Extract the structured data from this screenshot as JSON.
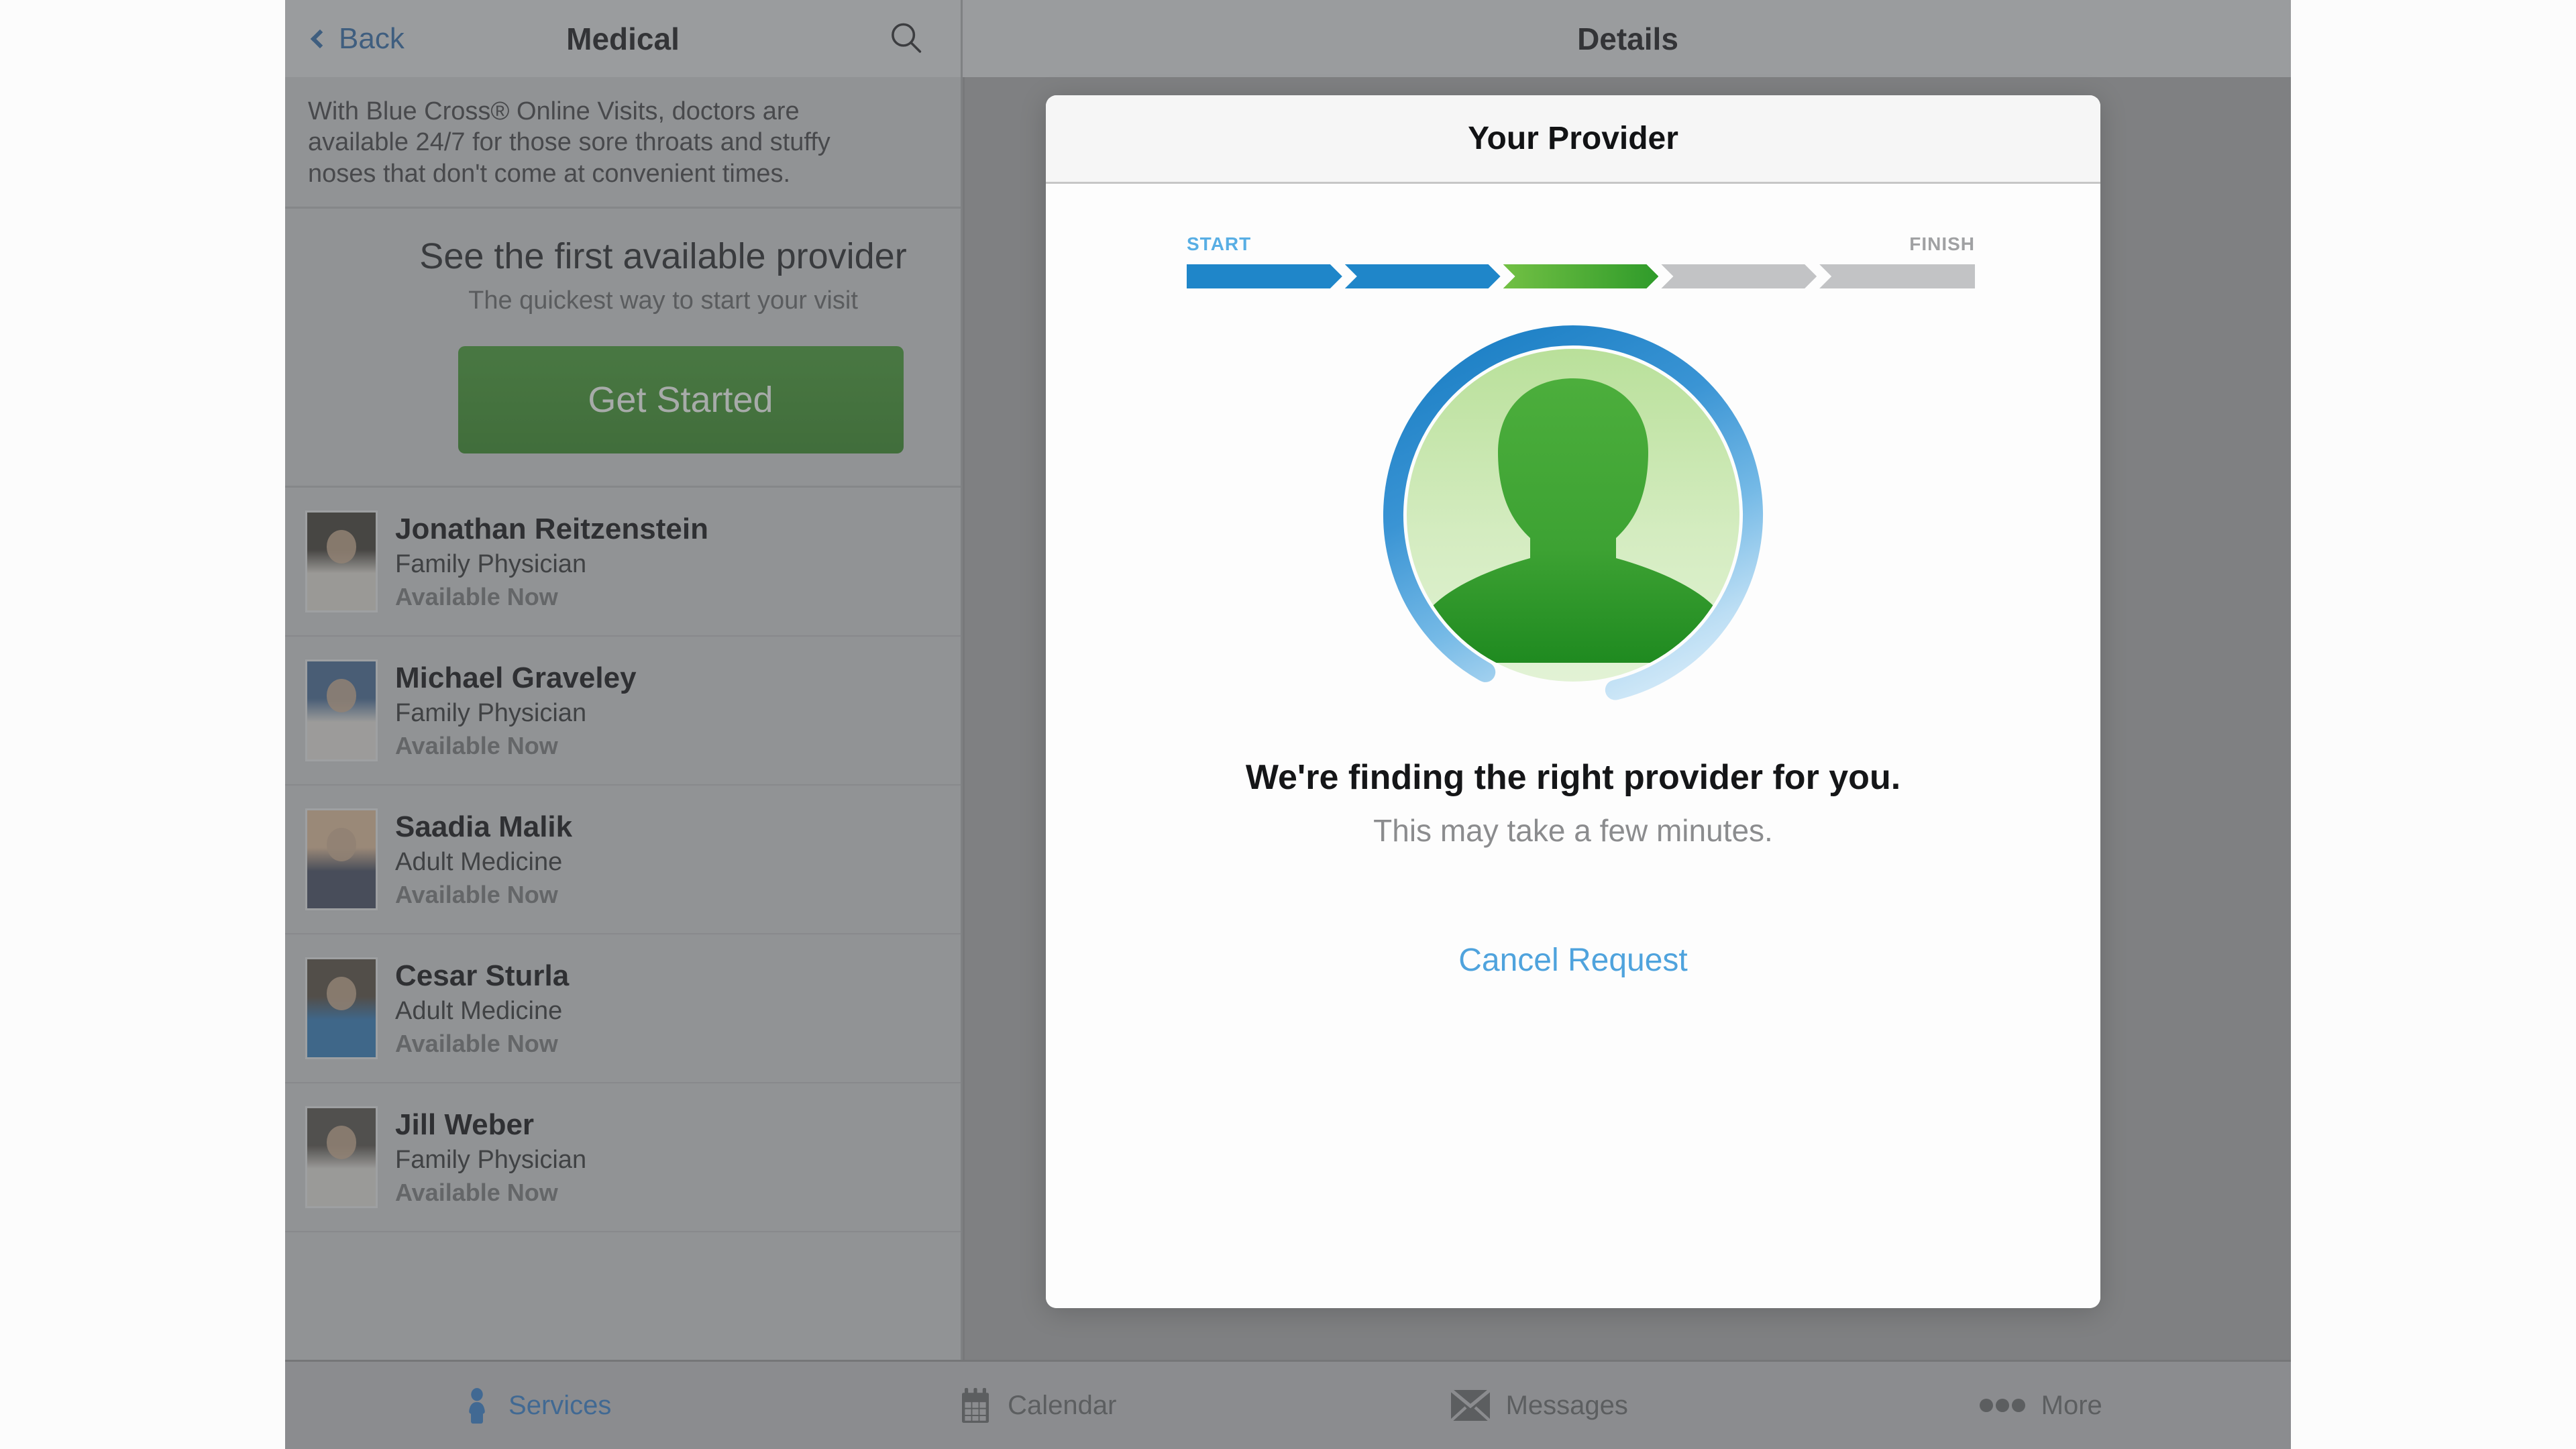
{
  "navbar": {
    "back_label": "Back",
    "left_title": "Medical",
    "right_title": "Details",
    "search_icon": "search-icon"
  },
  "sidebar": {
    "blurb": "With Blue Cross® Online Visits, doctors are\navailable 24/7 for those sore throats and stuffy\nnoses that don't come at convenient times.",
    "promo_title": "See the first available provider",
    "promo_sub": "The quickest way to start your visit",
    "get_started_label": "Get Started",
    "providers": [
      {
        "name": "Jonathan Reitzenstein",
        "specialty": "Family Physician",
        "availability": "Available Now"
      },
      {
        "name": "Michael Graveley",
        "specialty": "Family Physician",
        "availability": "Available Now"
      },
      {
        "name": "Saadia Malik",
        "specialty": "Adult Medicine",
        "availability": "Available Now"
      },
      {
        "name": "Cesar Sturla",
        "specialty": "Adult Medicine",
        "availability": "Available Now"
      },
      {
        "name": "Jill Weber",
        "specialty": "Family Physician",
        "availability": "Available Now"
      }
    ]
  },
  "tabbar": {
    "items": [
      {
        "label": "Services",
        "icon": "person-icon",
        "active": true
      },
      {
        "label": "Calendar",
        "icon": "calendar-icon",
        "active": false
      },
      {
        "label": "Messages",
        "icon": "envelope-icon",
        "active": false
      },
      {
        "label": "More",
        "icon": "ellipsis-icon",
        "active": false
      }
    ]
  },
  "modal": {
    "title": "Your Provider",
    "progress": {
      "start_label": "START",
      "finish_label": "FINISH",
      "segments": [
        "blue",
        "blue",
        "green",
        "gray",
        "gray"
      ],
      "completed_steps": 3,
      "total_steps": 5
    },
    "avatar_icon": "provider-avatar-spinner-icon",
    "status_main": "We're finding the right provider for you.",
    "status_sub": "This may take a few minutes.",
    "cancel_label": "Cancel Request"
  },
  "colors": {
    "accent_blue": "#1f86c9",
    "link_blue": "#4fa3dd",
    "start_blue": "#58aee4",
    "accent_green": "#2f9b2a",
    "button_green": "#3d8c2e",
    "gray_segment": "#c2c3c5"
  }
}
